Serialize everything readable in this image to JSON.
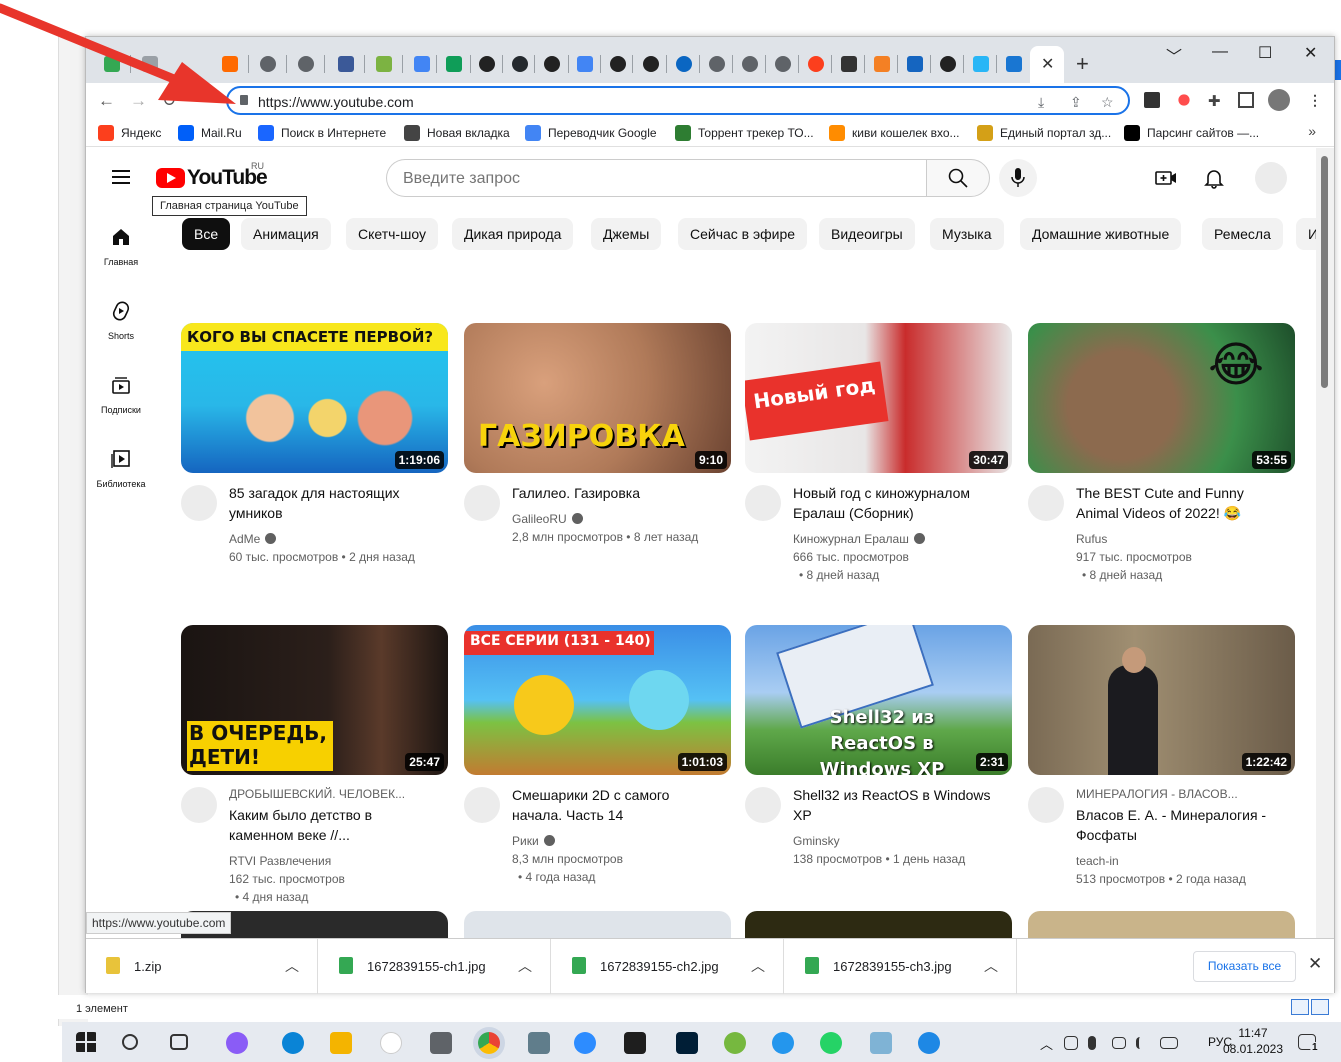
{
  "browser": {
    "url": "https://www.youtube.com",
    "new_tab": "+",
    "close_tab": "✕",
    "win_min": "﹀",
    "win_minimize": "—",
    "win_max": "☐",
    "win_close": "✕"
  },
  "bookmarks": [
    {
      "label": "Яндекс",
      "color": "#fc3f1d"
    },
    {
      "label": "Mail.Ru",
      "color": "#005ff9"
    },
    {
      "label": "Поиск в Интернете",
      "color": "#1a66ff"
    },
    {
      "label": "Новая вкладка",
      "color": "#444444"
    },
    {
      "label": "Переводчик Google",
      "color": "#4285f4"
    },
    {
      "label": "Торрент трекер ТО...",
      "color": "#2e7d32"
    },
    {
      "label": "киви кошелек вхо...",
      "color": "#ff8c00"
    },
    {
      "label": "Единый портал зд...",
      "color": "#d4a017"
    },
    {
      "label": "Парсинг сайтов —...",
      "color": "#000000"
    }
  ],
  "youtube": {
    "logo_text": "YouTube",
    "region": "RU",
    "logo_tooltip": "Главная страница YouTube",
    "search_placeholder": "Введите запрос",
    "sidebar": [
      {
        "label": "Главная",
        "icon": "home-icon"
      },
      {
        "label": "Shorts",
        "icon": "shorts-icon"
      },
      {
        "label": "Подписки",
        "icon": "subscriptions-icon"
      },
      {
        "label": "Библиотека",
        "icon": "library-icon"
      }
    ],
    "chips": [
      "Все",
      "Анимация",
      "Скетч-шоу",
      "Дикая природа",
      "Джемы",
      "Сейчас в эфире",
      "Видеоигры",
      "Музыка",
      "Домашние животные",
      "Ремесла",
      "И"
    ],
    "videos": [
      {
        "title": "85 загадок для настоящих умников",
        "channel": "AdMe",
        "verified": true,
        "views": "60 тыс. просмотров",
        "age": "• 2 дня назад",
        "duration": "1:19:06",
        "overlay": "КОГО ВЫ СПАСЕТЕ ПЕРВОЙ?"
      },
      {
        "title": "Галилео. Газировка",
        "channel": "GalileoRU",
        "verified": true,
        "views": "2,8 млн просмотров",
        "age": "• 8 лет назад",
        "duration": "9:10",
        "overlay": "ГАЗИРОВКА"
      },
      {
        "title": "Новый год с киножурналом Ералаш (Сборник)",
        "channel": "Киножурнал Ералаш",
        "verified": true,
        "views": "666 тыс. просмотров",
        "age": "• 8 дней назад",
        "duration": "30:47",
        "overlay": "Новый год"
      },
      {
        "title": "The BEST Cute and Funny Animal Videos of 2022! 😂",
        "channel": "Rufus",
        "verified": false,
        "views": "917 тыс. просмотров",
        "age": "• 8 дней назад",
        "duration": "53:55",
        "overlay": "😂"
      },
      {
        "title": "Каким было детство в каменном веке //...",
        "channel_top": "ДРОБЫШЕВСКИЙ. ЧЕЛОВЕК...",
        "channel": "RTVI Развлечения",
        "verified": false,
        "views": "162 тыс. просмотров",
        "age": "• 4 дня назад",
        "duration": "25:47",
        "overlay": "В ОЧЕРЕДЬ, ДЕТИ!"
      },
      {
        "title": "Смешарики 2D с самого начала. Часть 14",
        "channel": "Рики",
        "verified": true,
        "views": "8,3 млн просмотров",
        "age": "• 4 года назад",
        "duration": "1:01:03",
        "overlay": "ВСЕ СЕРИИ (131 - 140)"
      },
      {
        "title": "Shell32 из ReactOS в Windows XP",
        "channel": "Gminsky",
        "verified": false,
        "views": "138 просмотров",
        "age": "• 1 день назад",
        "duration": "2:31",
        "overlay": "Shell32 из ReactOS в Windows XP"
      },
      {
        "title": "Власов Е. А. - Минералогия - Фосфаты",
        "channel_top": "МИНЕРАЛОГИЯ - ВЛАСОВ...",
        "channel": "teach-in",
        "verified": false,
        "views": "513 просмотров",
        "age": "• 2 года назад",
        "duration": "1:22:42",
        "overlay": ""
      }
    ]
  },
  "status_url": "https://www.youtube.com",
  "downloads": {
    "items": [
      "1.zip",
      "1672839155-ch1.jpg",
      "1672839155-ch2.jpg",
      "1672839155-ch3.jpg"
    ],
    "show_all": "Показать все",
    "close": "✕"
  },
  "explorer_status": "1 элемент",
  "taskbar": {
    "lang": "РУС",
    "time": "11:47",
    "date": "08.01.2023",
    "notif_count": "1"
  },
  "colors": {
    "accent": "#1a73e8",
    "youtube_red": "#ff0000",
    "annotation_arrow": "#e8352b"
  }
}
